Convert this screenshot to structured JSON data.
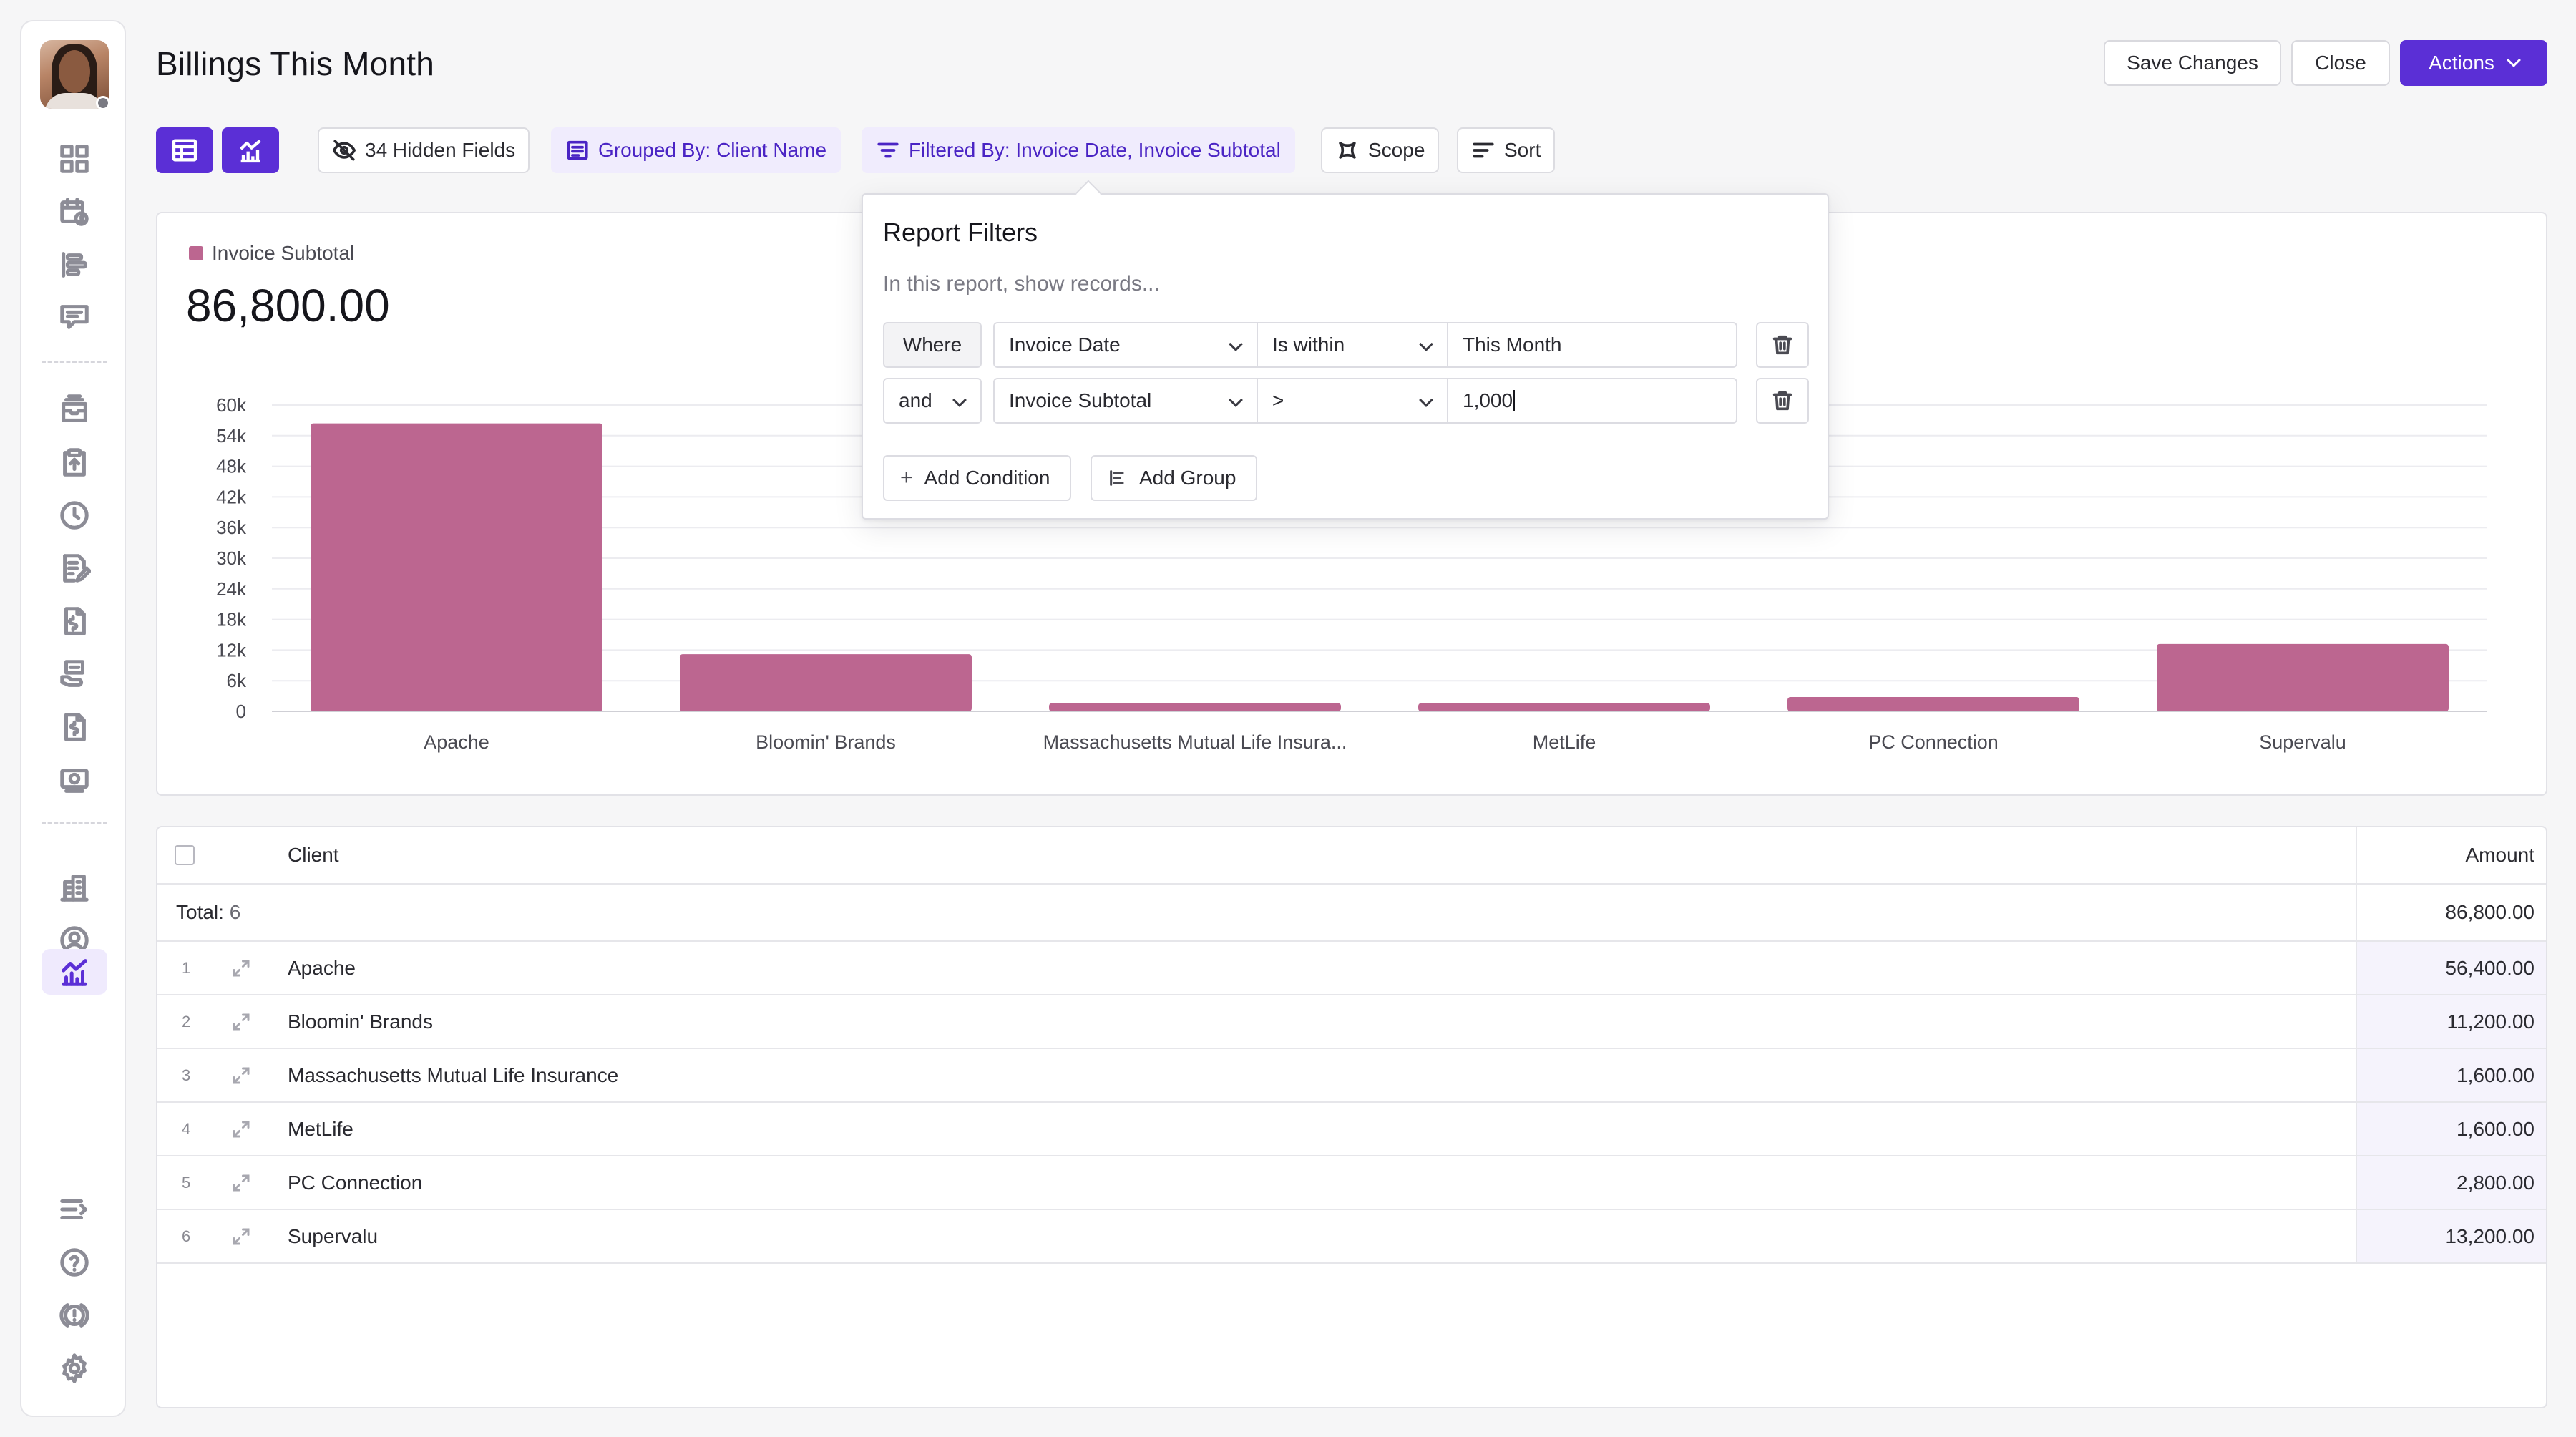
{
  "page": {
    "title": "Billings This Month"
  },
  "header_buttons": {
    "save": "Save Changes",
    "close": "Close",
    "actions": "Actions"
  },
  "colors": {
    "accent": "#5b2fd6",
    "bar": "#bc6690",
    "accent_light": "#f0ecfd"
  },
  "sidebar": {
    "nav_icons": [
      "dashboard-icon",
      "calendar-clock-icon",
      "timeline-icon",
      "messages-icon",
      "inbox-icon",
      "task-upload-icon",
      "clock-icon",
      "notes-icon",
      "invoice-icon",
      "payments-icon",
      "billing-doc-icon",
      "expenses-icon",
      "company-icon",
      "contacts-icon",
      "reports-icon",
      "collapse-menu-icon",
      "help-icon",
      "feedback-icon",
      "settings-icon"
    ]
  },
  "toolbar": {
    "hidden_fields": "34 Hidden Fields",
    "grouped_by": "Grouped By: Client Name",
    "filtered_by": "Filtered By: Invoice Date, Invoice Subtotal",
    "scope": "Scope",
    "sort": "Sort"
  },
  "chart_summary": {
    "legend_label": "Invoice Subtotal",
    "total": "86,800.00"
  },
  "chart_data": {
    "type": "bar",
    "categories": [
      "Apache",
      "Bloomin' Brands",
      "Massachusetts Mutual Life Insura...",
      "MetLife",
      "PC Connection",
      "Supervalu"
    ],
    "series": [
      {
        "name": "Invoice Subtotal",
        "values": [
          56400,
          11200,
          1600,
          1600,
          2800,
          13200
        ]
      }
    ],
    "ylim": [
      0,
      60000
    ],
    "yticks": [
      "0",
      "6k",
      "12k",
      "18k",
      "24k",
      "30k",
      "36k",
      "42k",
      "48k",
      "54k",
      "60k"
    ],
    "ytick_values": [
      0,
      6000,
      12000,
      18000,
      24000,
      30000,
      36000,
      42000,
      48000,
      54000,
      60000
    ],
    "grid": true,
    "legend": "top-left"
  },
  "table": {
    "headers": {
      "client": "Client",
      "amount": "Amount"
    },
    "total_label": "Total:",
    "total_count": "6",
    "total_amount": "86,800.00",
    "rows": [
      {
        "index": "1",
        "client": "Apache",
        "amount": "56,400.00"
      },
      {
        "index": "2",
        "client": "Bloomin' Brands",
        "amount": "11,200.00"
      },
      {
        "index": "3",
        "client": "Massachusetts Mutual Life Insurance",
        "amount": "1,600.00"
      },
      {
        "index": "4",
        "client": "MetLife",
        "amount": "1,600.00"
      },
      {
        "index": "5",
        "client": "PC Connection",
        "amount": "2,800.00"
      },
      {
        "index": "6",
        "client": "Supervalu",
        "amount": "13,200.00"
      }
    ]
  },
  "filters": {
    "title": "Report Filters",
    "subtitle": "In this report, show records...",
    "conditions": [
      {
        "conj": "Where",
        "field": "Invoice Date",
        "operator": "Is within",
        "value": "This Month"
      },
      {
        "conj": "and",
        "field": "Invoice Subtotal",
        "operator": ">",
        "value": "1,000"
      }
    ],
    "add_condition": "Add Condition",
    "add_group": "Add Group"
  }
}
